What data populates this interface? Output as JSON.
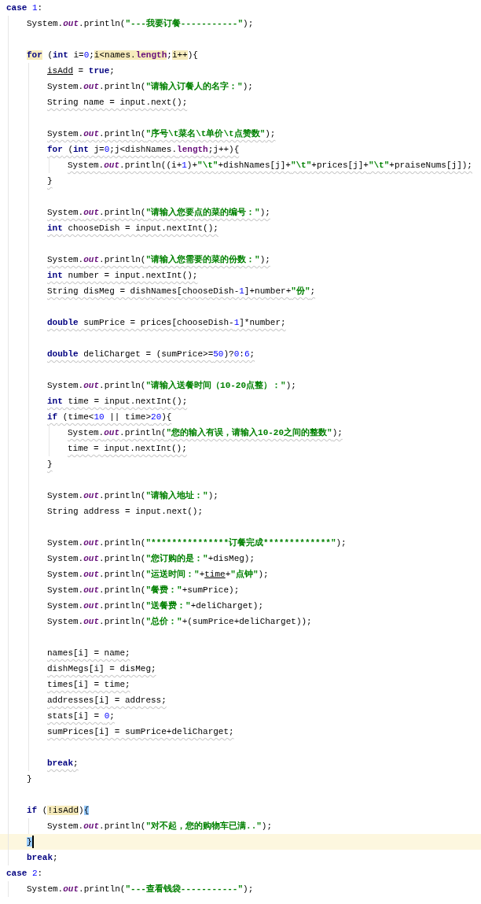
{
  "editor": {
    "lines": [
      {
        "kind": "code",
        "tokens": [
          {
            "text": "case",
            "kind": "keyword"
          },
          {
            "text": " 1",
            "kind": "number"
          },
          {
            "text": ":",
            "kind": "plain"
          }
        ],
        "children": [
          {
            "kind": "code",
            "tokens": [
              {
                "text": "System.",
                "kind": "plain"
              },
              {
                "text": "out",
                "kind": "field"
              },
              {
                "text": ".println(",
                "kind": "plain"
              },
              {
                "text": "\"---我要订餐-----------\"",
                "kind": "string"
              },
              {
                "text": ");",
                "kind": "plain"
              }
            ]
          },
          {
            "kind": "blank"
          },
          {
            "kind": "code",
            "tokens": [
              {
                "text": "for",
                "kind": "keyword",
                "highlighted": true
              },
              {
                "text": " (",
                "kind": "plain"
              },
              {
                "text": "int",
                "kind": "keyword"
              },
              {
                "text": " i=",
                "kind": "plain"
              },
              {
                "text": "0",
                "kind": "number"
              },
              {
                "text": ";",
                "kind": "plain"
              },
              {
                "text": "i<names.",
                "kind": "plain",
                "highlighted": true
              },
              {
                "text": "length",
                "kind": "member",
                "highlighted": true
              },
              {
                "text": ";",
                "kind": "plain"
              },
              {
                "text": "i++",
                "kind": "plain",
                "highlighted": true
              },
              {
                "text": "){",
                "kind": "plain"
              }
            ],
            "children": [
              {
                "kind": "code",
                "tokens": [
                  {
                    "text": "isAdd",
                    "kind": "plain",
                    "underlined": true
                  },
                  {
                    "text": " = ",
                    "kind": "plain"
                  },
                  {
                    "text": "true",
                    "kind": "keyword"
                  },
                  {
                    "text": ";",
                    "kind": "plain"
                  }
                ]
              },
              {
                "kind": "code",
                "tokens": [
                  {
                    "text": "System.",
                    "kind": "plain"
                  },
                  {
                    "text": "out",
                    "kind": "field"
                  },
                  {
                    "text": ".println(",
                    "kind": "plain"
                  },
                  {
                    "text": "\"请输入订餐人的名字：\"",
                    "kind": "string"
                  },
                  {
                    "text": ");",
                    "kind": "plain"
                  }
                ]
              },
              {
                "kind": "code",
                "warning": true,
                "tokens": [
                  {
                    "text": "String name = input.next();",
                    "kind": "plain"
                  }
                ]
              },
              {
                "kind": "blank"
              },
              {
                "kind": "code",
                "warning": true,
                "tokens": [
                  {
                    "text": "System.",
                    "kind": "plain"
                  },
                  {
                    "text": "out",
                    "kind": "field"
                  },
                  {
                    "text": ".println(",
                    "kind": "plain"
                  },
                  {
                    "text": "\"序号\\t菜名\\t单价\\t点赞数\"",
                    "kind": "string"
                  },
                  {
                    "text": ");",
                    "kind": "plain"
                  }
                ]
              },
              {
                "kind": "code",
                "warning": true,
                "tokens": [
                  {
                    "text": "for",
                    "kind": "keyword"
                  },
                  {
                    "text": " (",
                    "kind": "plain"
                  },
                  {
                    "text": "int",
                    "kind": "keyword"
                  },
                  {
                    "text": " j=",
                    "kind": "plain"
                  },
                  {
                    "text": "0",
                    "kind": "number"
                  },
                  {
                    "text": ";j<dishNames.",
                    "kind": "plain"
                  },
                  {
                    "text": "length",
                    "kind": "member"
                  },
                  {
                    "text": ";j++){",
                    "kind": "plain"
                  }
                ],
                "children": [
                  {
                    "kind": "code",
                    "warning": true,
                    "tokens": [
                      {
                        "text": "System.",
                        "kind": "plain"
                      },
                      {
                        "text": "out",
                        "kind": "field"
                      },
                      {
                        "text": ".println((i+",
                        "kind": "plain"
                      },
                      {
                        "text": "1",
                        "kind": "number"
                      },
                      {
                        "text": ")+",
                        "kind": "plain"
                      },
                      {
                        "text": "\"\\t\"",
                        "kind": "string"
                      },
                      {
                        "text": "+dishNames[j]+",
                        "kind": "plain"
                      },
                      {
                        "text": "\"\\t\"",
                        "kind": "string"
                      },
                      {
                        "text": "+prices[j]+",
                        "kind": "plain"
                      },
                      {
                        "text": "\"\\t\"",
                        "kind": "string"
                      },
                      {
                        "text": "+praiseNums[j]);",
                        "kind": "plain"
                      }
                    ]
                  }
                ]
              },
              {
                "kind": "code",
                "warning": true,
                "tokens": [
                  {
                    "text": "}",
                    "kind": "plain"
                  }
                ]
              },
              {
                "kind": "blank"
              },
              {
                "kind": "code",
                "warning": true,
                "tokens": [
                  {
                    "text": "System.",
                    "kind": "plain"
                  },
                  {
                    "text": "out",
                    "kind": "field"
                  },
                  {
                    "text": ".println(",
                    "kind": "plain"
                  },
                  {
                    "text": "\"请输入您要点的菜的编号：\"",
                    "kind": "string"
                  },
                  {
                    "text": ");",
                    "kind": "plain"
                  }
                ]
              },
              {
                "kind": "code",
                "warning": true,
                "tokens": [
                  {
                    "text": "int",
                    "kind": "keyword"
                  },
                  {
                    "text": " chooseDish = input.nextInt();",
                    "kind": "plain"
                  }
                ]
              },
              {
                "kind": "blank"
              },
              {
                "kind": "code",
                "warning": true,
                "tokens": [
                  {
                    "text": "System.",
                    "kind": "plain"
                  },
                  {
                    "text": "out",
                    "kind": "field"
                  },
                  {
                    "text": ".println(",
                    "kind": "plain"
                  },
                  {
                    "text": "\"请输入您需要的菜的份数：\"",
                    "kind": "string"
                  },
                  {
                    "text": ");",
                    "kind": "plain"
                  }
                ]
              },
              {
                "kind": "code",
                "warning": true,
                "tokens": [
                  {
                    "text": "int",
                    "kind": "keyword"
                  },
                  {
                    "text": " number = input.nextInt();",
                    "kind": "plain"
                  }
                ]
              },
              {
                "kind": "code",
                "warning": true,
                "tokens": [
                  {
                    "text": "String disMeg = dishNames[chooseDish-",
                    "kind": "plain"
                  },
                  {
                    "text": "1",
                    "kind": "number"
                  },
                  {
                    "text": "]+number+",
                    "kind": "plain"
                  },
                  {
                    "text": "\"份\"",
                    "kind": "string"
                  },
                  {
                    "text": ";",
                    "kind": "plain"
                  }
                ]
              },
              {
                "kind": "blank"
              },
              {
                "kind": "code",
                "warning": true,
                "tokens": [
                  {
                    "text": "double",
                    "kind": "keyword"
                  },
                  {
                    "text": " sumPrice = prices[chooseDish-",
                    "kind": "plain"
                  },
                  {
                    "text": "1",
                    "kind": "number"
                  },
                  {
                    "text": "]*number;",
                    "kind": "plain"
                  }
                ]
              },
              {
                "kind": "blank"
              },
              {
                "kind": "code",
                "warning": true,
                "tokens": [
                  {
                    "text": "double",
                    "kind": "keyword"
                  },
                  {
                    "text": " deliCharget = (sumPrice>=",
                    "kind": "plain"
                  },
                  {
                    "text": "50",
                    "kind": "number"
                  },
                  {
                    "text": ")?",
                    "kind": "plain"
                  },
                  {
                    "text": "0",
                    "kind": "number"
                  },
                  {
                    "text": ":",
                    "kind": "plain"
                  },
                  {
                    "text": "6",
                    "kind": "number"
                  },
                  {
                    "text": ";",
                    "kind": "plain"
                  }
                ]
              },
              {
                "kind": "blank"
              },
              {
                "kind": "code",
                "tokens": [
                  {
                    "text": "System.",
                    "kind": "plain"
                  },
                  {
                    "text": "out",
                    "kind": "field"
                  },
                  {
                    "text": ".println(",
                    "kind": "plain"
                  },
                  {
                    "text": "\"请输入送餐时间（10-20点整）：\"",
                    "kind": "string"
                  },
                  {
                    "text": ");",
                    "kind": "plain"
                  }
                ]
              },
              {
                "kind": "code",
                "warning": true,
                "tokens": [
                  {
                    "text": "int",
                    "kind": "keyword"
                  },
                  {
                    "text": " time = input.nextInt();",
                    "kind": "plain"
                  }
                ]
              },
              {
                "kind": "code",
                "warning": true,
                "tokens": [
                  {
                    "text": "if",
                    "kind": "keyword"
                  },
                  {
                    "text": " (time<",
                    "kind": "plain"
                  },
                  {
                    "text": "10",
                    "kind": "number"
                  },
                  {
                    "text": " || time>",
                    "kind": "plain"
                  },
                  {
                    "text": "20",
                    "kind": "number"
                  },
                  {
                    "text": "){",
                    "kind": "plain"
                  }
                ],
                "children": [
                  {
                    "kind": "code",
                    "warning": true,
                    "tokens": [
                      {
                        "text": "System.",
                        "kind": "plain"
                      },
                      {
                        "text": "out",
                        "kind": "field"
                      },
                      {
                        "text": ".println(",
                        "kind": "plain"
                      },
                      {
                        "text": "\"您的输入有误，请输入10-20之间的整数\"",
                        "kind": "string"
                      },
                      {
                        "text": ");",
                        "kind": "plain"
                      }
                    ]
                  },
                  {
                    "kind": "code",
                    "warning": true,
                    "tokens": [
                      {
                        "text": "time = input.nextInt();",
                        "kind": "plain"
                      }
                    ]
                  }
                ]
              },
              {
                "kind": "code",
                "warning": true,
                "tokens": [
                  {
                    "text": "}",
                    "kind": "plain"
                  }
                ]
              },
              {
                "kind": "blank"
              },
              {
                "kind": "code",
                "tokens": [
                  {
                    "text": "System.",
                    "kind": "plain"
                  },
                  {
                    "text": "out",
                    "kind": "field"
                  },
                  {
                    "text": ".println(",
                    "kind": "plain"
                  },
                  {
                    "text": "\"请输入地址：\"",
                    "kind": "string"
                  },
                  {
                    "text": ");",
                    "kind": "plain"
                  }
                ]
              },
              {
                "kind": "code",
                "tokens": [
                  {
                    "text": "String address = input.next();",
                    "kind": "plain"
                  }
                ]
              },
              {
                "kind": "blank"
              },
              {
                "kind": "code",
                "tokens": [
                  {
                    "text": "System.",
                    "kind": "plain"
                  },
                  {
                    "text": "out",
                    "kind": "field"
                  },
                  {
                    "text": ".println(",
                    "kind": "plain"
                  },
                  {
                    "text": "\"***************订餐完成*************\"",
                    "kind": "string"
                  },
                  {
                    "text": ");",
                    "kind": "plain"
                  }
                ]
              },
              {
                "kind": "code",
                "tokens": [
                  {
                    "text": "System.",
                    "kind": "plain"
                  },
                  {
                    "text": "out",
                    "kind": "field"
                  },
                  {
                    "text": ".println(",
                    "kind": "plain"
                  },
                  {
                    "text": "\"您订购的是：\"",
                    "kind": "string"
                  },
                  {
                    "text": "+disMeg);",
                    "kind": "plain"
                  }
                ]
              },
              {
                "kind": "code",
                "tokens": [
                  {
                    "text": "System.",
                    "kind": "plain"
                  },
                  {
                    "text": "out",
                    "kind": "field"
                  },
                  {
                    "text": ".println(",
                    "kind": "plain"
                  },
                  {
                    "text": "\"运送时间：\"",
                    "kind": "string"
                  },
                  {
                    "text": "+",
                    "kind": "plain"
                  },
                  {
                    "text": "time",
                    "kind": "plain",
                    "underlined": true
                  },
                  {
                    "text": "+",
                    "kind": "plain"
                  },
                  {
                    "text": "\"点钟\"",
                    "kind": "string"
                  },
                  {
                    "text": ");",
                    "kind": "plain"
                  }
                ]
              },
              {
                "kind": "code",
                "tokens": [
                  {
                    "text": "System.",
                    "kind": "plain"
                  },
                  {
                    "text": "out",
                    "kind": "field"
                  },
                  {
                    "text": ".println(",
                    "kind": "plain"
                  },
                  {
                    "text": "\"餐费：\"",
                    "kind": "string"
                  },
                  {
                    "text": "+sumPrice);",
                    "kind": "plain"
                  }
                ]
              },
              {
                "kind": "code",
                "tokens": [
                  {
                    "text": "System.",
                    "kind": "plain"
                  },
                  {
                    "text": "out",
                    "kind": "field"
                  },
                  {
                    "text": ".println(",
                    "kind": "plain"
                  },
                  {
                    "text": "\"送餐费：\"",
                    "kind": "string"
                  },
                  {
                    "text": "+deliCharget);",
                    "kind": "plain"
                  }
                ]
              },
              {
                "kind": "code",
                "tokens": [
                  {
                    "text": "System.",
                    "kind": "plain"
                  },
                  {
                    "text": "out",
                    "kind": "field"
                  },
                  {
                    "text": ".println(",
                    "kind": "plain"
                  },
                  {
                    "text": "\"总价：\"",
                    "kind": "string"
                  },
                  {
                    "text": "+(sumPrice+deliCharget));",
                    "kind": "plain"
                  }
                ]
              },
              {
                "kind": "blank"
              },
              {
                "kind": "code",
                "warning": true,
                "tokens": [
                  {
                    "text": "names[i] = name;",
                    "kind": "plain"
                  }
                ]
              },
              {
                "kind": "code",
                "warning": true,
                "tokens": [
                  {
                    "text": "dishMegs[i] = disMeg;",
                    "kind": "plain"
                  }
                ]
              },
              {
                "kind": "code",
                "warning": true,
                "tokens": [
                  {
                    "text": "times[i] = time;",
                    "kind": "plain"
                  }
                ]
              },
              {
                "kind": "code",
                "warning": true,
                "tokens": [
                  {
                    "text": "addresses[i] = address;",
                    "kind": "plain"
                  }
                ]
              },
              {
                "kind": "code",
                "warning": true,
                "tokens": [
                  {
                    "text": "stats[i] = ",
                    "kind": "plain"
                  },
                  {
                    "text": "0",
                    "kind": "number"
                  },
                  {
                    "text": ";",
                    "kind": "plain"
                  }
                ]
              },
              {
                "kind": "code",
                "warning": true,
                "tokens": [
                  {
                    "text": "sumPrices[i] = sumPrice+deliCharget;",
                    "kind": "plain"
                  }
                ]
              },
              {
                "kind": "blank"
              },
              {
                "kind": "code",
                "warning": true,
                "tokens": [
                  {
                    "text": "break",
                    "kind": "keyword"
                  },
                  {
                    "text": ";",
                    "kind": "plain"
                  }
                ]
              }
            ]
          },
          {
            "kind": "code",
            "tokens": [
              {
                "text": "}",
                "kind": "plain"
              }
            ]
          },
          {
            "kind": "blank"
          },
          {
            "kind": "code",
            "tokens": [
              {
                "text": "if",
                "kind": "keyword"
              },
              {
                "text": " (",
                "kind": "plain"
              },
              {
                "text": "!isAdd",
                "kind": "plain",
                "highlighted": true
              },
              {
                "text": ")",
                "kind": "plain"
              },
              {
                "text": "{",
                "kind": "plain",
                "brace_match": true
              }
            ],
            "children": [
              {
                "kind": "code",
                "tokens": [
                  {
                    "text": "System.",
                    "kind": "plain"
                  },
                  {
                    "text": "out",
                    "kind": "field"
                  },
                  {
                    "text": ".println(",
                    "kind": "plain"
                  },
                  {
                    "text": "\"对不起，您的购物车已满..\"",
                    "kind": "string"
                  },
                  {
                    "text": ");",
                    "kind": "plain"
                  }
                ]
              }
            ]
          },
          {
            "kind": "code",
            "current": true,
            "caret": true,
            "tokens": [
              {
                "text": "}",
                "kind": "plain",
                "brace_match": true
              }
            ]
          },
          {
            "kind": "code",
            "tokens": [
              {
                "text": "break",
                "kind": "keyword"
              },
              {
                "text": ";",
                "kind": "plain"
              }
            ]
          }
        ]
      },
      {
        "kind": "code",
        "tokens": [
          {
            "text": "case",
            "kind": "keyword"
          },
          {
            "text": " 2",
            "kind": "number"
          },
          {
            "text": ":",
            "kind": "plain"
          }
        ],
        "children": [
          {
            "kind": "code",
            "tokens": [
              {
                "text": "System.",
                "kind": "plain"
              },
              {
                "text": "out",
                "kind": "field"
              },
              {
                "text": ".println(",
                "kind": "plain"
              },
              {
                "text": "\"---查看钱袋-----------\"",
                "kind": "string"
              },
              {
                "text": ");",
                "kind": "plain"
              }
            ]
          }
        ]
      }
    ]
  }
}
